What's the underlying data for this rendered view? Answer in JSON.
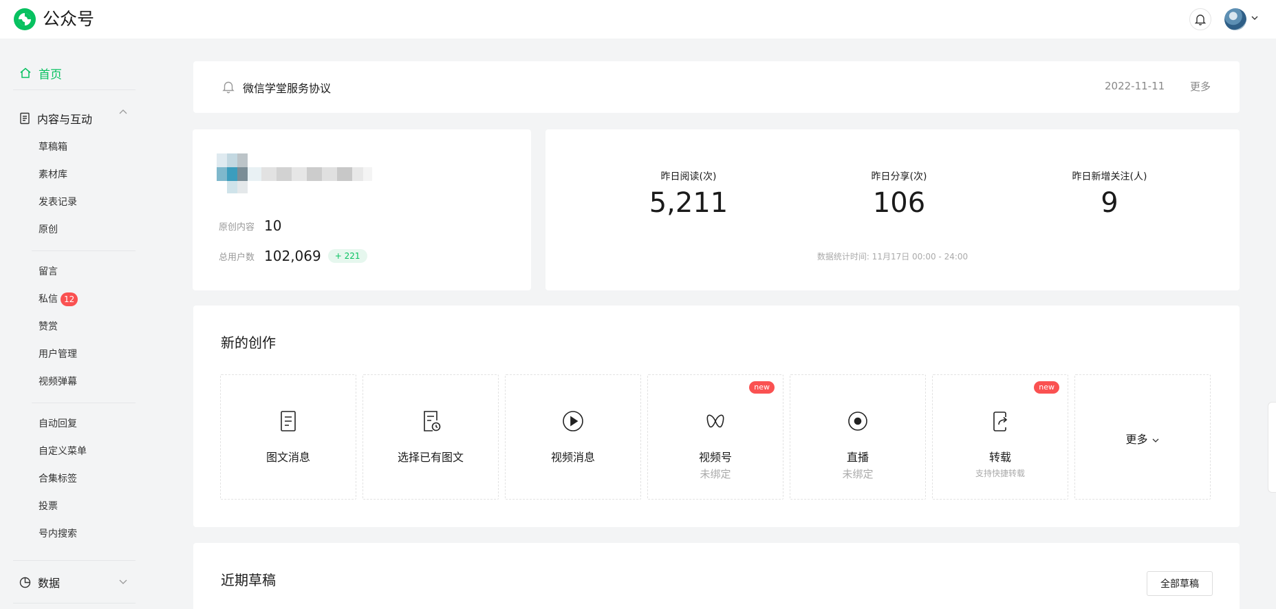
{
  "header": {
    "brand": "公众号",
    "bell_icon": "bell-icon",
    "avatar_icon": "avatar"
  },
  "sidebar": {
    "home": "首页",
    "content_group": "内容与互动",
    "content_items": [
      "草稿箱",
      "素材库",
      "发表记录",
      "原创"
    ],
    "interaction_items": [
      "留言",
      "私信",
      "赞赏",
      "用户管理",
      "视频弹幕"
    ],
    "private_msg_badge": "12",
    "tool_items": [
      "自动回复",
      "自定义菜单",
      "合集标签",
      "投票",
      "号内搜索"
    ],
    "data_group": "数据"
  },
  "notice": {
    "title": "微信学堂服务协议",
    "date": "2022-11-11",
    "more": "更多"
  },
  "account": {
    "original_label": "原创内容",
    "original_value": "10",
    "users_label": "总用户数",
    "users_value": "102,069",
    "users_growth": "+ 221"
  },
  "stats": {
    "metrics": [
      {
        "label": "昨日阅读(次)",
        "value": "5,211"
      },
      {
        "label": "昨日分享(次)",
        "value": "106"
      },
      {
        "label": "昨日新增关注(人)",
        "value": "9"
      }
    ],
    "footnote": "数据统计时间: 11月17日 00:00 - 24:00"
  },
  "create": {
    "title": "新的创作",
    "new_badge": "new",
    "tiles": [
      {
        "label": "图文消息",
        "sub": ""
      },
      {
        "label": "选择已有图文",
        "sub": ""
      },
      {
        "label": "视频消息",
        "sub": ""
      },
      {
        "label": "视频号",
        "sub": "未绑定"
      },
      {
        "label": "直播",
        "sub": "未绑定"
      },
      {
        "label": "转载",
        "sub": "支持快捷转载"
      }
    ],
    "more": "更多"
  },
  "drafts": {
    "title": "近期草稿",
    "all_button": "全部草稿"
  },
  "colors": {
    "accent": "#07c160",
    "badge": "#fa5151",
    "page_bg": "#f3f4f5"
  }
}
